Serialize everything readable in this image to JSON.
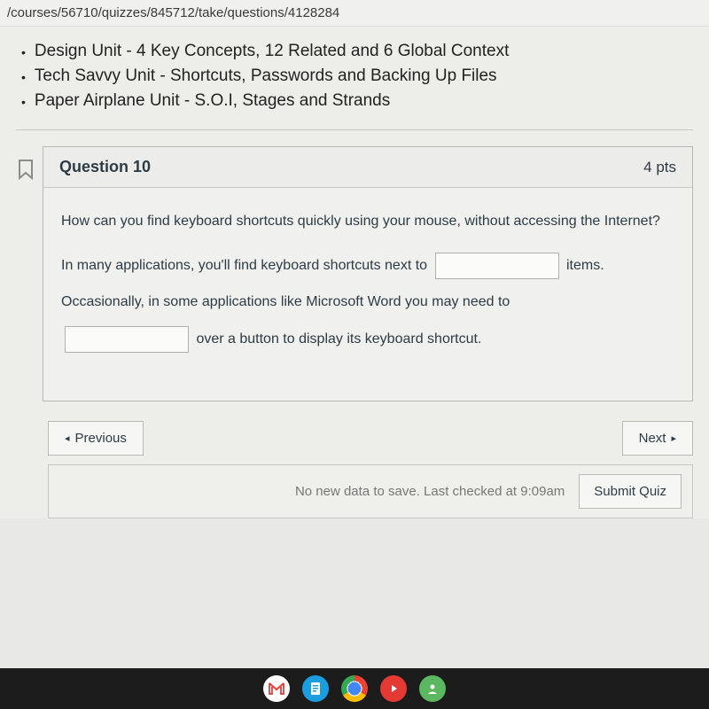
{
  "url": "/courses/56710/quizzes/845712/take/questions/4128284",
  "intro_items": [
    "Design Unit - 4 Key Concepts, 12 Related and 6 Global Context",
    "Tech Savvy Unit - Shortcuts, Passwords and Backing Up Files",
    "Paper Airplane Unit - S.O.I, Stages and Strands"
  ],
  "question": {
    "title": "Question 10",
    "points": "4 pts",
    "prompt": "How can you find keyboard shortcuts quickly using your mouse, without accessing the Internet?",
    "line1_a": "In many applications, you'll find keyboard shortcuts next to",
    "line1_b": "items.",
    "line2": "Occasionally, in some applications like Microsoft Word you may need to",
    "line3": "over a button to display its keyboard shortcut."
  },
  "nav": {
    "previous": "Previous",
    "next": "Next"
  },
  "save_status": "No new data to save. Last checked at 9:09am",
  "submit": "Submit Quiz"
}
